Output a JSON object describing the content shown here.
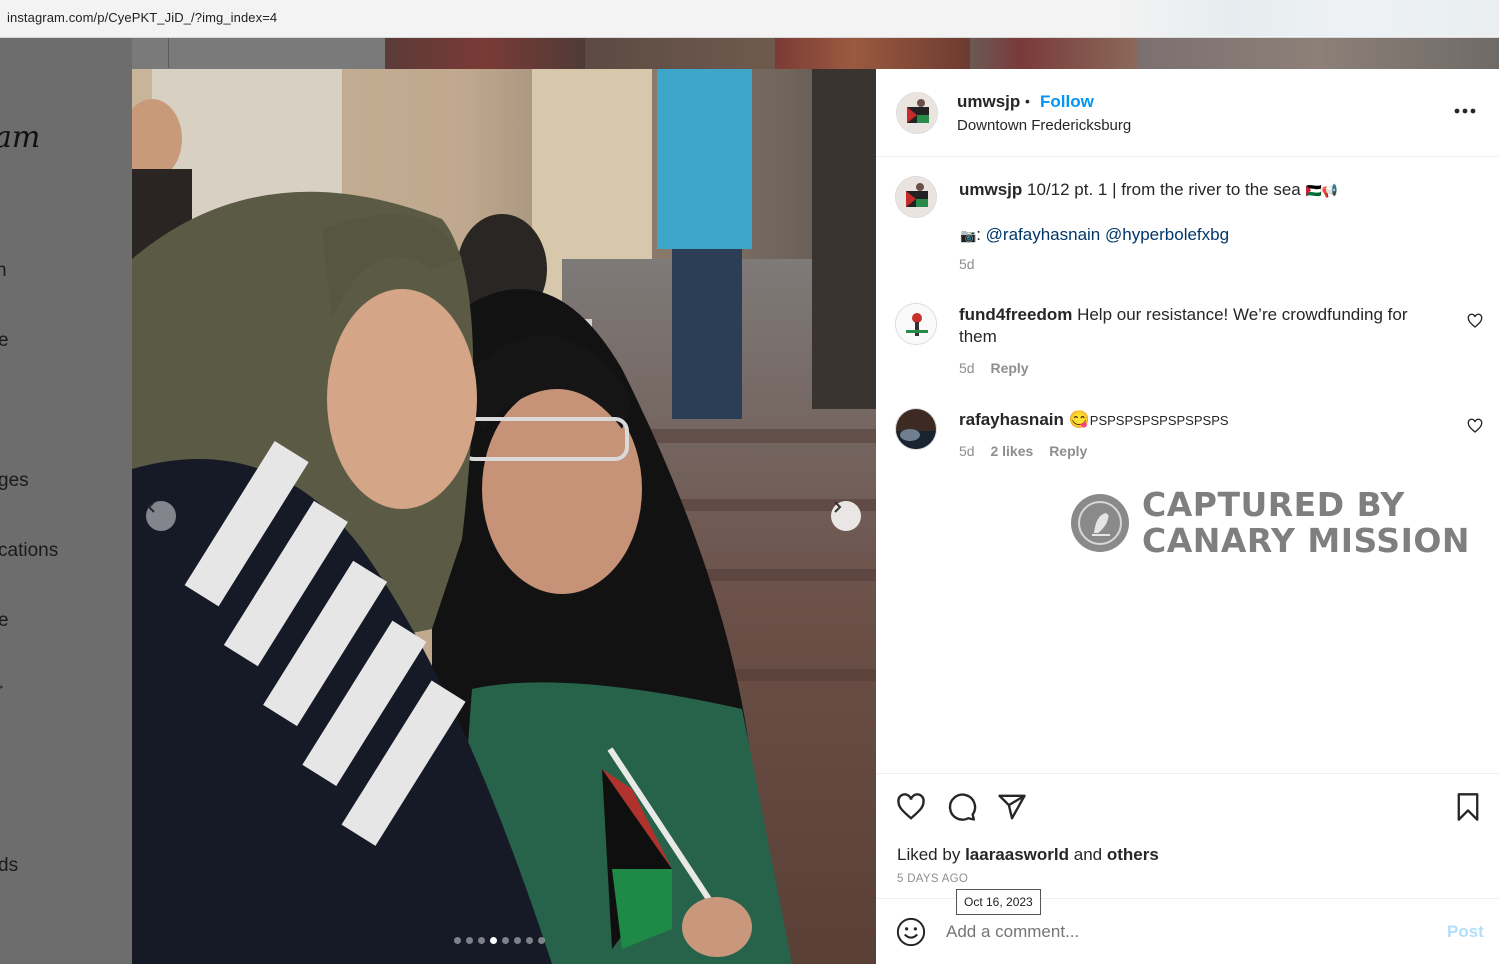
{
  "browser": {
    "url": "instagram.com/p/CyePKT_JiD_/?img_index=4"
  },
  "leftnav": {
    "logo": "am",
    "items": [
      "n",
      "e",
      "ges",
      "cations",
      "e",
      ">",
      "ds"
    ]
  },
  "post": {
    "username": "umwsjp",
    "separator": "•",
    "follow_label": "Follow",
    "location": "Downtown Fredericksburg",
    "more_icon": "more-horizontal-icon",
    "carousel": {
      "total": 8,
      "active_index": 3
    }
  },
  "caption": {
    "username": "umwsjp",
    "text": "10/12 pt. 1 | from the river to the sea",
    "flag_emoji": "🇵🇸📢",
    "camera_emoji": "📷",
    "colon": ":",
    "mention1": "@rafayhasnain",
    "mention2": "@hyperbolefxbg",
    "time": "5d"
  },
  "comments": [
    {
      "username": "fund4freedom",
      "text": "Help our resistance! We’re crowdfunding for them",
      "time": "5d",
      "likes": "",
      "reply_label": "Reply"
    },
    {
      "username": "rafayhasnain",
      "emoji": "😋",
      "text": "PSPSPSPSPSPSPSPS",
      "time": "5d",
      "likes": "2 likes",
      "reply_label": "Reply"
    }
  ],
  "watermark": {
    "line1": "CAPTURED BY",
    "line2": "CANARY MISSION"
  },
  "likes": {
    "prefix": "Liked by",
    "user": "laaraasworld",
    "and": "and",
    "others": "others"
  },
  "timestamp": "5 DAYS AGO",
  "tooltip": "Oct 16, 2023",
  "comment_box": {
    "placeholder": "Add a comment...",
    "post_label": "Post"
  },
  "colors": {
    "accent": "#0095f6",
    "link": "#00376b",
    "muted": "#8e8e8e"
  }
}
